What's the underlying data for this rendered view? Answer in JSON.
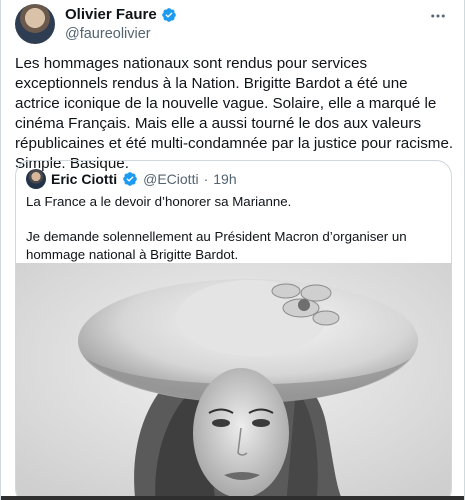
{
  "tweet": {
    "author": {
      "display_name": "Olivier Faure",
      "handle": "@faureolivier",
      "verified": true
    },
    "more_icon": "more-dots-icon",
    "text": "Les hommages nationaux sont rendus pour services exceptionnels rendus à la Nation. Brigitte Bardot a été une actrice iconique de la nouvelle vague. Solaire, elle a marqué le cinéma Français. Mais elle a aussi tourné le dos aux valeurs républicaines et été multi-condamnée par la justice pour racisme. Simple. Basique."
  },
  "quote": {
    "author": {
      "display_name": "Eric Ciotti",
      "handle": "@ECiotti",
      "verified": true
    },
    "separator": "·",
    "time": "19h",
    "paragraphs": [
      "La France a le devoir d’honorer sa Marianne.",
      "Je demande solennellement au Président Macron d’organiser un hommage national à Brigitte Bardot."
    ]
  },
  "colors": {
    "verified": "#1d9bf0",
    "text": "#0f1419",
    "secondary": "#536471",
    "border": "#cfd9de"
  },
  "icons": {
    "verified": "verified-badge-icon"
  }
}
